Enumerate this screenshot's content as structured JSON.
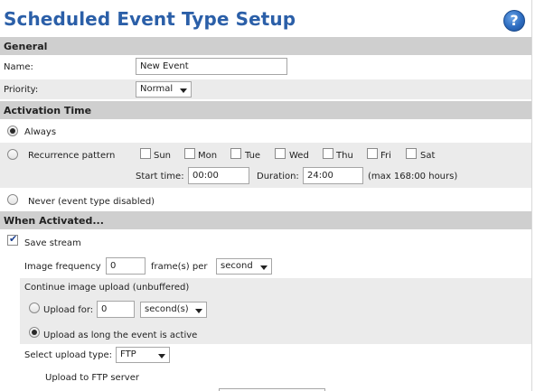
{
  "page": {
    "title": "Scheduled Event Type Setup",
    "help": "?"
  },
  "general": {
    "header": "General",
    "name_label": "Name:",
    "name_value": "New Event",
    "priority_label": "Priority:",
    "priority_value": "Normal"
  },
  "activation": {
    "header": "Activation Time",
    "always_label": "Always",
    "recurrence_label": "Recurrence pattern",
    "days": [
      {
        "label": "Sun",
        "checked": false
      },
      {
        "label": "Mon",
        "checked": false
      },
      {
        "label": "Tue",
        "checked": false
      },
      {
        "label": "Wed",
        "checked": false
      },
      {
        "label": "Thu",
        "checked": false
      },
      {
        "label": "Fri",
        "checked": false
      },
      {
        "label": "Sat",
        "checked": false
      }
    ],
    "start_time_label": "Start time:",
    "start_time_value": "00:00",
    "duration_label": "Duration:",
    "duration_value": "24:00",
    "duration_note": "(max 168:00 hours)",
    "never_label": "Never (event type disabled)",
    "selected": "Always"
  },
  "when_activated": {
    "header": "When Activated...",
    "save_stream_label": "Save stream",
    "save_stream_checked": true,
    "image_frequency_label": "Image frequency",
    "image_frequency_value": "0",
    "frames_per_label": "frame(s) per",
    "frequency_unit": "second",
    "continue_upload_label": "Continue image upload (unbuffered)",
    "upload_for_label": "Upload for:",
    "upload_for_value": "0",
    "upload_for_unit": "second(s)",
    "upload_active_label": "Upload as long the event is active",
    "upload_type_label": "Select upload type:",
    "upload_type_value": "FTP",
    "upload_to_label": "Upload to FTP server"
  },
  "colors": {
    "title": "#2b5fa8",
    "header_bg": "#cfcfcf",
    "band_bg": "#ebebeb"
  }
}
